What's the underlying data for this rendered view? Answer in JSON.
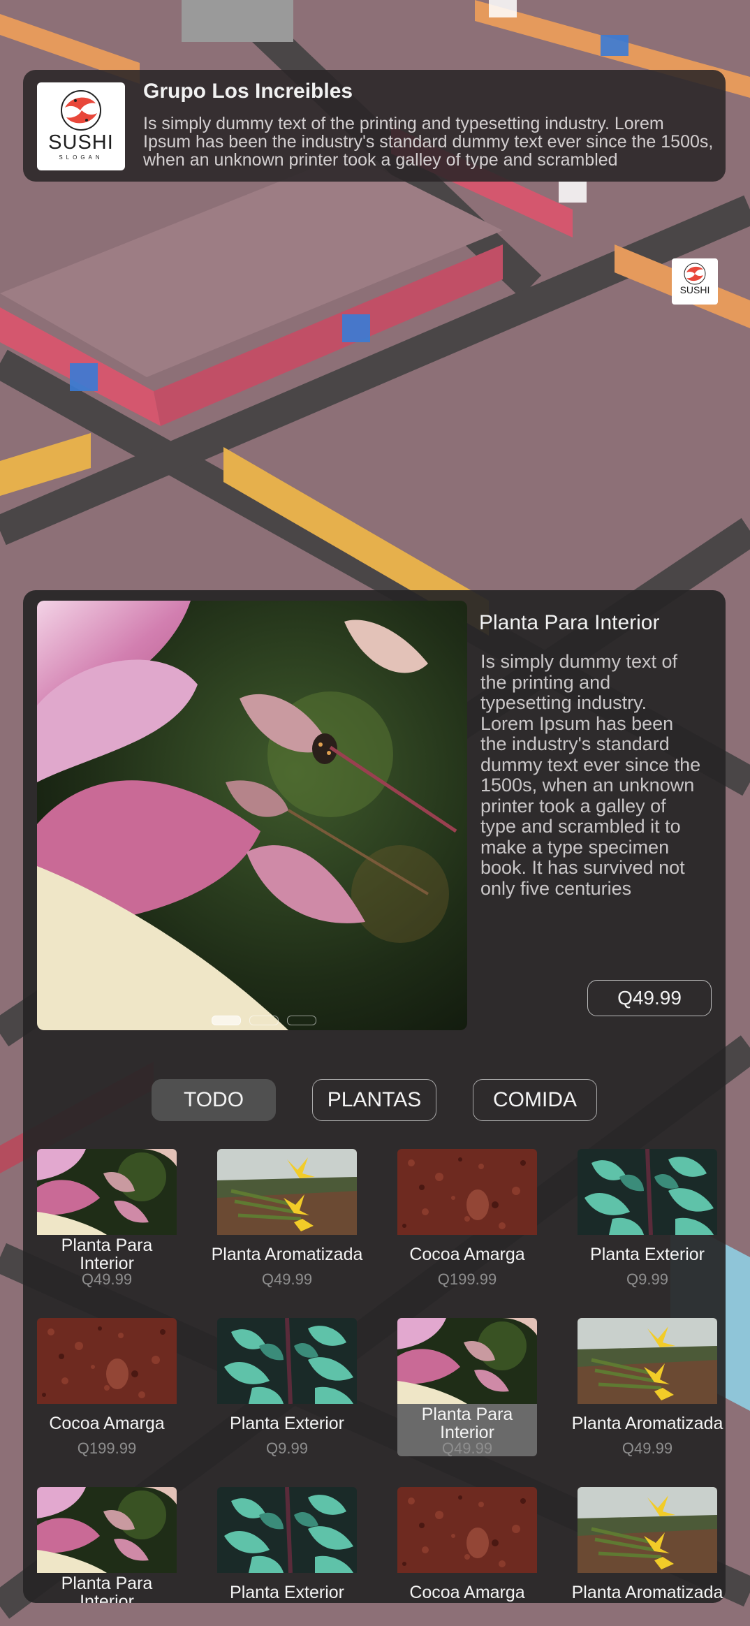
{
  "header": {
    "title": "Grupo Los Increibles",
    "description": "Is simply dummy text of the printing and typesetting industry. Lorem Ipsum has been the industry's standard dummy text ever since the 1500s, when an unknown printer took a galley of type and scrambled",
    "logo_text": "SUSHI",
    "logo_slogan": "SLOGAN"
  },
  "featured": {
    "title": "Planta Para Interior",
    "description": "Is simply dummy text of the printing and typesetting industry. Lorem Ipsum has been the industry's standard dummy text ever since the 1500s, when an unknown printer took a galley of type and scrambled it to make a type specimen book. It has survived not only five centuries",
    "price": "Q49.99",
    "carousel": {
      "count": 3,
      "active": 0
    }
  },
  "filters": [
    {
      "label": "TODO",
      "selected": true
    },
    {
      "label": "PLANTAS",
      "selected": false
    },
    {
      "label": "COMIDA",
      "selected": false
    }
  ],
  "products": [
    {
      "name": "Planta Para Interior",
      "price": "Q49.99",
      "image": "pink-flower"
    },
    {
      "name": "Planta Aromatizada",
      "price": "Q49.99",
      "image": "yellow-flower"
    },
    {
      "name": "Cocoa Amarga",
      "price": "Q199.99",
      "image": "cocoa-soil"
    },
    {
      "name": "Planta Exterior",
      "price": "Q9.99",
      "image": "jade-vine"
    },
    {
      "name": "Cocoa Amarga",
      "price": "Q199.99",
      "image": "cocoa-soil"
    },
    {
      "name": "Planta Exterior",
      "price": "Q9.99",
      "image": "jade-vine"
    },
    {
      "name": "Planta Para Interior",
      "price": "Q49.99",
      "image": "pink-flower",
      "selected": true
    },
    {
      "name": "Planta Aromatizada",
      "price": "Q49.99",
      "image": "yellow-flower"
    },
    {
      "name": "Planta Para Interior",
      "price": "",
      "image": "pink-flower"
    },
    {
      "name": "Planta Exterior",
      "price": "",
      "image": "jade-vine"
    },
    {
      "name": "Cocoa Amarga",
      "price": "",
      "image": "cocoa-soil"
    },
    {
      "name": "Planta Aromatizada",
      "price": "",
      "image": "yellow-flower"
    }
  ],
  "colors": {
    "panel": "#262526",
    "accent_selected": "#505050"
  }
}
